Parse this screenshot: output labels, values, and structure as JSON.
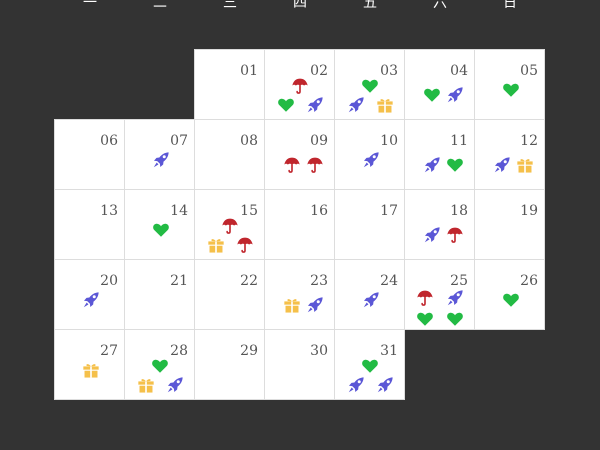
{
  "colors": {
    "background": "#333333",
    "cell": "#ffffff",
    "grid_line": "#dddddd",
    "day_number": "#555555",
    "heart": "#22bb44",
    "rocket": "#5b57d6",
    "umbrella": "#c0262d",
    "gift": "#f5c04a"
  },
  "calendar": {
    "weekdays": [
      "一",
      "二",
      "三",
      "四",
      "五",
      "六",
      "日"
    ],
    "first_weekday_index": 2,
    "days": [
      {
        "day": "01",
        "events": []
      },
      {
        "day": "02",
        "events": [
          "umbrella-icon",
          "heart-icon",
          "rocket-icon"
        ]
      },
      {
        "day": "03",
        "events": [
          "heart-icon",
          "rocket-icon",
          "gift-icon"
        ]
      },
      {
        "day": "04",
        "events": [
          "heart-icon",
          "rocket-icon"
        ]
      },
      {
        "day": "05",
        "events": [
          "heart-icon"
        ]
      },
      {
        "day": "06",
        "events": []
      },
      {
        "day": "07",
        "events": [
          "rocket-icon"
        ]
      },
      {
        "day": "08",
        "events": []
      },
      {
        "day": "09",
        "events": [
          "umbrella-icon",
          "umbrella-icon"
        ]
      },
      {
        "day": "10",
        "events": [
          "rocket-icon"
        ]
      },
      {
        "day": "11",
        "events": [
          "rocket-icon",
          "heart-icon"
        ]
      },
      {
        "day": "12",
        "events": [
          "rocket-icon",
          "gift-icon"
        ]
      },
      {
        "day": "13",
        "events": []
      },
      {
        "day": "14",
        "events": [
          "heart-icon"
        ]
      },
      {
        "day": "15",
        "events": [
          "umbrella-icon",
          "gift-icon",
          "umbrella-icon"
        ]
      },
      {
        "day": "16",
        "events": []
      },
      {
        "day": "17",
        "events": []
      },
      {
        "day": "18",
        "events": [
          "rocket-icon",
          "umbrella-icon"
        ]
      },
      {
        "day": "19",
        "events": []
      },
      {
        "day": "20",
        "events": [
          "rocket-icon"
        ]
      },
      {
        "day": "21",
        "events": []
      },
      {
        "day": "22",
        "events": []
      },
      {
        "day": "23",
        "events": [
          "gift-icon",
          "rocket-icon"
        ]
      },
      {
        "day": "24",
        "events": [
          "rocket-icon"
        ]
      },
      {
        "day": "25",
        "events": [
          "umbrella-icon",
          "rocket-icon",
          "heart-icon",
          "heart-icon"
        ]
      },
      {
        "day": "26",
        "events": [
          "heart-icon"
        ]
      },
      {
        "day": "27",
        "events": [
          "gift-icon"
        ]
      },
      {
        "day": "28",
        "events": [
          "heart-icon",
          "gift-icon",
          "rocket-icon"
        ]
      },
      {
        "day": "29",
        "events": []
      },
      {
        "day": "30",
        "events": []
      },
      {
        "day": "31",
        "events": [
          "heart-icon",
          "rocket-icon",
          "rocket-icon"
        ]
      }
    ]
  }
}
